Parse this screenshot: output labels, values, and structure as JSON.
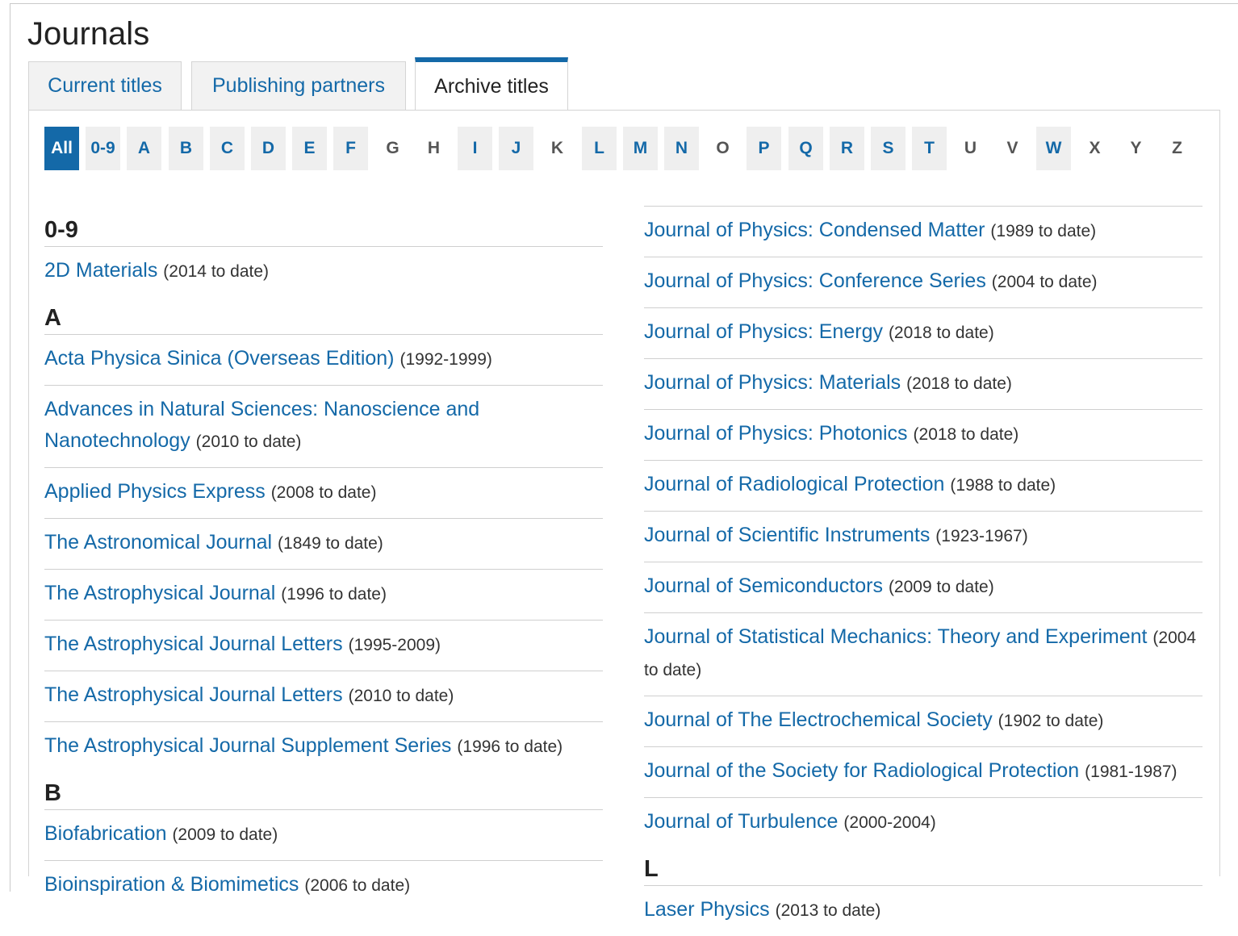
{
  "page_title": "Journals",
  "tabs": [
    {
      "label": "Current titles",
      "active": false
    },
    {
      "label": "Publishing partners",
      "active": false
    },
    {
      "label": "Archive titles",
      "active": true
    }
  ],
  "letters": [
    {
      "label": "All",
      "state": "selected"
    },
    {
      "label": "0-9",
      "state": "enabled"
    },
    {
      "label": "A",
      "state": "enabled"
    },
    {
      "label": "B",
      "state": "enabled"
    },
    {
      "label": "C",
      "state": "enabled"
    },
    {
      "label": "D",
      "state": "enabled"
    },
    {
      "label": "E",
      "state": "enabled"
    },
    {
      "label": "F",
      "state": "enabled"
    },
    {
      "label": "G",
      "state": "disabled"
    },
    {
      "label": "H",
      "state": "disabled"
    },
    {
      "label": "I",
      "state": "enabled"
    },
    {
      "label": "J",
      "state": "enabled"
    },
    {
      "label": "K",
      "state": "disabled"
    },
    {
      "label": "L",
      "state": "enabled"
    },
    {
      "label": "M",
      "state": "enabled"
    },
    {
      "label": "N",
      "state": "enabled"
    },
    {
      "label": "O",
      "state": "disabled"
    },
    {
      "label": "P",
      "state": "enabled"
    },
    {
      "label": "Q",
      "state": "enabled"
    },
    {
      "label": "R",
      "state": "enabled"
    },
    {
      "label": "S",
      "state": "enabled"
    },
    {
      "label": "T",
      "state": "enabled"
    },
    {
      "label": "U",
      "state": "disabled"
    },
    {
      "label": "V",
      "state": "disabled"
    },
    {
      "label": "W",
      "state": "enabled"
    },
    {
      "label": "X",
      "state": "disabled"
    },
    {
      "label": "Y",
      "state": "disabled"
    },
    {
      "label": "Z",
      "state": "disabled"
    }
  ],
  "left_column": [
    {
      "heading": "0-9"
    },
    {
      "title": "2D Materials",
      "years": "(2014 to date)"
    },
    {
      "heading": "A"
    },
    {
      "title": "Acta Physica Sinica (Overseas Edition)",
      "years": "(1992-1999)"
    },
    {
      "title": "Advances in Natural Sciences: Nanoscience and Nanotechnology",
      "years": "(2010 to date)"
    },
    {
      "title": "Applied Physics Express",
      "years": "(2008 to date)"
    },
    {
      "title": "The Astronomical Journal",
      "years": "(1849 to date)"
    },
    {
      "title": "The Astrophysical Journal",
      "years": "(1996 to date)"
    },
    {
      "title": "The Astrophysical Journal Letters",
      "years": "(1995-2009)"
    },
    {
      "title": "The Astrophysical Journal Letters",
      "years": "(2010 to date)"
    },
    {
      "title": "The Astrophysical Journal Supplement Series",
      "years": "(1996 to date)"
    },
    {
      "heading": "B"
    },
    {
      "title": "Biofabrication",
      "years": "(2009 to date)"
    },
    {
      "title": "Bioinspiration & Biomimetics",
      "years": "(2006 to date)"
    }
  ],
  "right_column": [
    {
      "title": "Journal of Physics: Condensed Matter",
      "years": "(1989 to date)"
    },
    {
      "title": "Journal of Physics: Conference Series",
      "years": "(2004 to date)"
    },
    {
      "title": "Journal of Physics: Energy",
      "years": "(2018 to date)"
    },
    {
      "title": "Journal of Physics: Materials",
      "years": "(2018 to date)"
    },
    {
      "title": "Journal of Physics: Photonics",
      "years": "(2018 to date)"
    },
    {
      "title": "Journal of Radiological Protection",
      "years": "(1988 to date)"
    },
    {
      "title": "Journal of Scientific Instruments",
      "years": "(1923-1967)"
    },
    {
      "title": "Journal of Semiconductors",
      "years": "(2009 to date)"
    },
    {
      "title": "Journal of Statistical Mechanics: Theory and Experiment",
      "years": "(2004 to date)"
    },
    {
      "title": "Journal of The Electrochemical Society",
      "years": "(1902 to date)"
    },
    {
      "title": "Journal of the Society for Radiological Protection",
      "years": "(1981-1987)"
    },
    {
      "title": "Journal of Turbulence",
      "years": "(2000-2004)"
    },
    {
      "heading": "L"
    },
    {
      "title": "Laser Physics",
      "years": "(2013 to date)"
    }
  ],
  "colors": {
    "accent": "#1469a8",
    "tab_bg": "#f2f2f2",
    "letter_bg": "#efefef"
  }
}
